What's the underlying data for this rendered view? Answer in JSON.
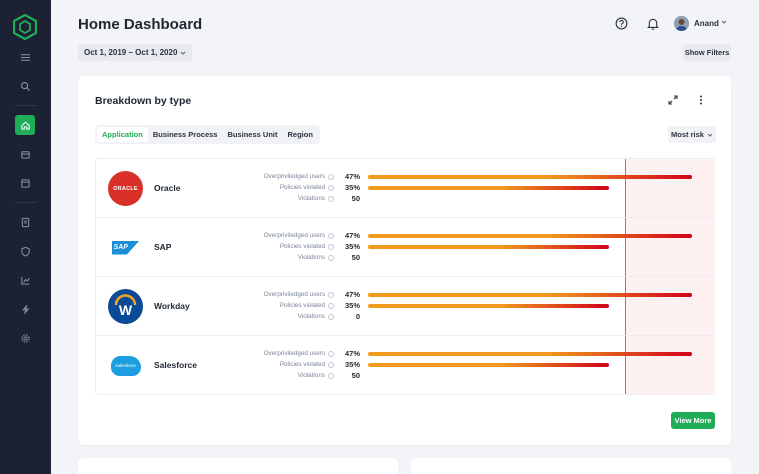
{
  "header": {
    "title": "Home Dashboard",
    "date_range": "Oct 1, 2019 – Oct 1, 2020",
    "user_name": "Anand",
    "show_filters_label": "Show Filters"
  },
  "sidebar": {
    "items": [
      {
        "icon": "menu-icon"
      },
      {
        "icon": "search-icon"
      },
      {
        "icon": "home-icon",
        "active": true
      },
      {
        "icon": "box-icon"
      },
      {
        "icon": "window-icon"
      },
      {
        "icon": "report-icon"
      },
      {
        "icon": "shield-icon"
      },
      {
        "icon": "chart-icon"
      },
      {
        "icon": "plug-icon"
      },
      {
        "icon": "settings-icon"
      }
    ]
  },
  "card": {
    "title": "Breakdown by type",
    "tabs": [
      {
        "label": "Application",
        "active": true
      },
      {
        "label": "Business Process"
      },
      {
        "label": "Business Unit"
      },
      {
        "label": "Region"
      }
    ],
    "sort_label": "Most risk",
    "view_more_label": "View More",
    "metric_labels": {
      "overprivileged": "Overpriviledged users",
      "policies": "Policies violated",
      "violations": "Violations"
    },
    "rows": [
      {
        "name": "Oracle",
        "logo": "oracle-logo",
        "logo_text": "ORACLE",
        "overprivileged": "47%",
        "policies": "35%",
        "violations": "50",
        "overprivileged_frac": 0.47,
        "policies_frac": 0.35
      },
      {
        "name": "SAP",
        "logo": "sap-logo",
        "logo_text": "SAP",
        "overprivileged": "47%",
        "policies": "35%",
        "violations": "50",
        "overprivileged_frac": 0.47,
        "policies_frac": 0.35
      },
      {
        "name": "Workday",
        "logo": "workday-logo",
        "logo_text": "W",
        "overprivileged": "47%",
        "policies": "35%",
        "violations": "0",
        "overprivileged_frac": 0.47,
        "policies_frac": 0.35
      },
      {
        "name": "Salesforce",
        "logo": "salesforce-logo",
        "logo_text": "salesforce",
        "overprivileged": "47%",
        "policies": "35%",
        "violations": "50",
        "overprivileged_frac": 0.47,
        "policies_frac": 0.35
      }
    ]
  },
  "colors": {
    "accent": "#1fae57",
    "sidebar": "#1c2233",
    "bar_start": "#f29a1e",
    "bar_end": "#d0021b",
    "oracle": "#d9302a",
    "sap": "#1a8fd8",
    "workday": "#0a4a96",
    "salesforce": "#1c9ee0"
  }
}
